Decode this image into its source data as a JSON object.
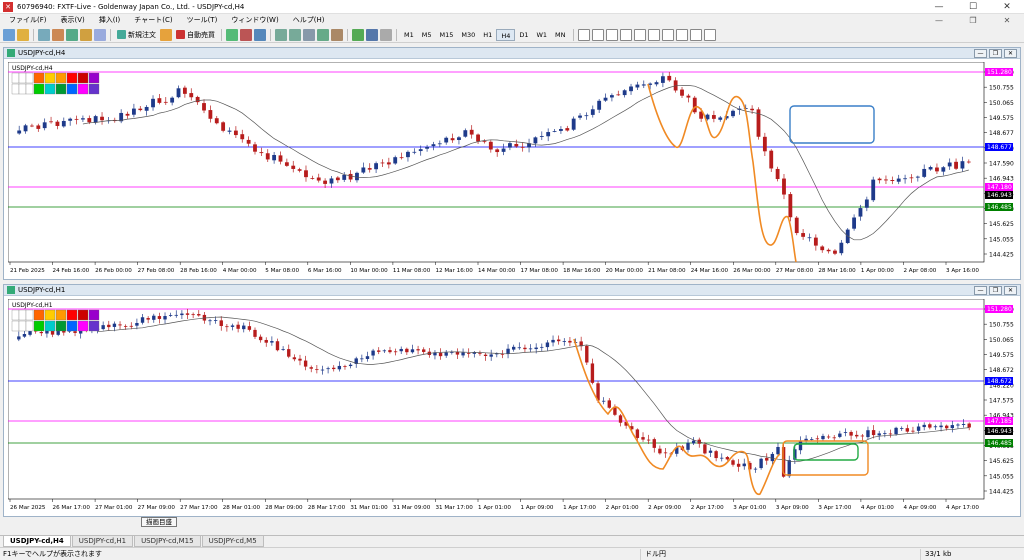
{
  "window": {
    "title": "60796940: FXTF-Live - Goldenway Japan Co., Ltd. - USDJPY-cd,H4",
    "controls": [
      "—",
      "☐",
      "✕"
    ]
  },
  "menu": {
    "items": [
      "ファイル(F)",
      "表示(V)",
      "挿入(I)",
      "チャート(C)",
      "ツール(T)",
      "ウィンドウ(W)",
      "ヘルプ(H)"
    ],
    "controls": [
      "—",
      "❐",
      "✕"
    ]
  },
  "toolbar": {
    "new_order_label": "新規注文",
    "auto_trade_label": "自動売買",
    "timeframes": [
      "M1",
      "M5",
      "M15",
      "M30",
      "H1",
      "H4",
      "D1",
      "W1",
      "MN"
    ],
    "active_timeframe": "H4"
  },
  "chart_top": {
    "window_title": "USDJPY-cd,H4",
    "symbol_label": "USDJPY-cd,H4",
    "price_axis_labels": [
      "151.280",
      "150.755",
      "150.065",
      "149.575",
      "148.677",
      "148.220",
      "147.590",
      "146.943",
      "146.485",
      "146.230",
      "145.625",
      "145.055",
      "144.425"
    ],
    "special_labels": [
      {
        "text": "151.280",
        "color": "#ff00ff"
      },
      {
        "text": "148.677",
        "color": "#0000ff"
      },
      {
        "text": "147.180",
        "color": "#ff00ff"
      },
      {
        "text": "146.943",
        "color": "#000000"
      },
      {
        "text": "146.485",
        "color": "#008000"
      }
    ],
    "time_labels": [
      "21 Feb 2025",
      "24 Feb 16:00",
      "26 Feb 00:00",
      "27 Feb 08:00",
      "28 Feb 16:00",
      "4 Mar 00:00",
      "5 Mar 08:00",
      "6 Mar 16:00",
      "10 Mar 00:00",
      "11 Mar 08:00",
      "12 Mar 16:00",
      "14 Mar 00:00",
      "17 Mar 08:00",
      "18 Mar 16:00",
      "20 Mar 00:00",
      "21 Mar 08:00",
      "24 Mar 16:00",
      "26 Mar 00:00",
      "27 Mar 08:00",
      "28 Mar 16:00",
      "1 Apr 00:00",
      "2 Apr 08:00",
      "3 Apr 16:00"
    ]
  },
  "chart_bottom": {
    "window_title": "USDJPY-cd,H1",
    "symbol_label": "USDJPY-cd,H1",
    "price_axis_labels": [
      "151.280",
      "150.755",
      "150.065",
      "149.575",
      "148.672",
      "148.220",
      "147.575",
      "146.943",
      "146.485",
      "146.315",
      "145.625",
      "145.055",
      "144.425"
    ],
    "special_labels": [
      {
        "text": "151.280",
        "color": "#ff00ff"
      },
      {
        "text": "148.672",
        "color": "#0000ff"
      },
      {
        "text": "147.185",
        "color": "#ff00ff"
      },
      {
        "text": "146.943",
        "color": "#000000"
      },
      {
        "text": "146.485",
        "color": "#008000"
      }
    ],
    "time_labels": [
      "26 Mar 2025",
      "26 Mar 17:00",
      "27 Mar 01:00",
      "27 Mar 09:00",
      "27 Mar 17:00",
      "28 Mar 01:00",
      "28 Mar 09:00",
      "28 Mar 17:00",
      "31 Mar 01:00",
      "31 Mar 09:00",
      "31 Mar 17:00",
      "1 Apr 01:00",
      "1 Apr 09:00",
      "1 Apr 17:00",
      "2 Apr 01:00",
      "2 Apr 09:00",
      "2 Apr 17:00",
      "3 Apr 01:00",
      "3 Apr 09:00",
      "3 Apr 17:00",
      "4 Apr 01:00",
      "4 Apr 09:00",
      "4 Apr 17:00"
    ]
  },
  "tabs": [
    "USDJPY-cd,H4",
    "USDJPY-cd,H1",
    "USDJPY-cd,M15",
    "USDJPY-cd,M5"
  ],
  "active_tab": "USDJPY-cd,H4",
  "tooltip": "描画目盛",
  "status": {
    "help": "F1キーでヘルプが表示されます",
    "profile": "ドル円",
    "traffic": "33/1 kb"
  },
  "colors": {
    "bull_candle": "#1e3a8a",
    "bear_candle": "#b71c1c",
    "moving_average": "#555555",
    "resistance_magenta": "#ff00ff",
    "level_blue": "#0000ff",
    "support_green": "#008000",
    "annotation_orange": "#f08a24",
    "annotation_blue_box": "#3a7fc8",
    "annotation_green_box": "#22aa44"
  }
}
